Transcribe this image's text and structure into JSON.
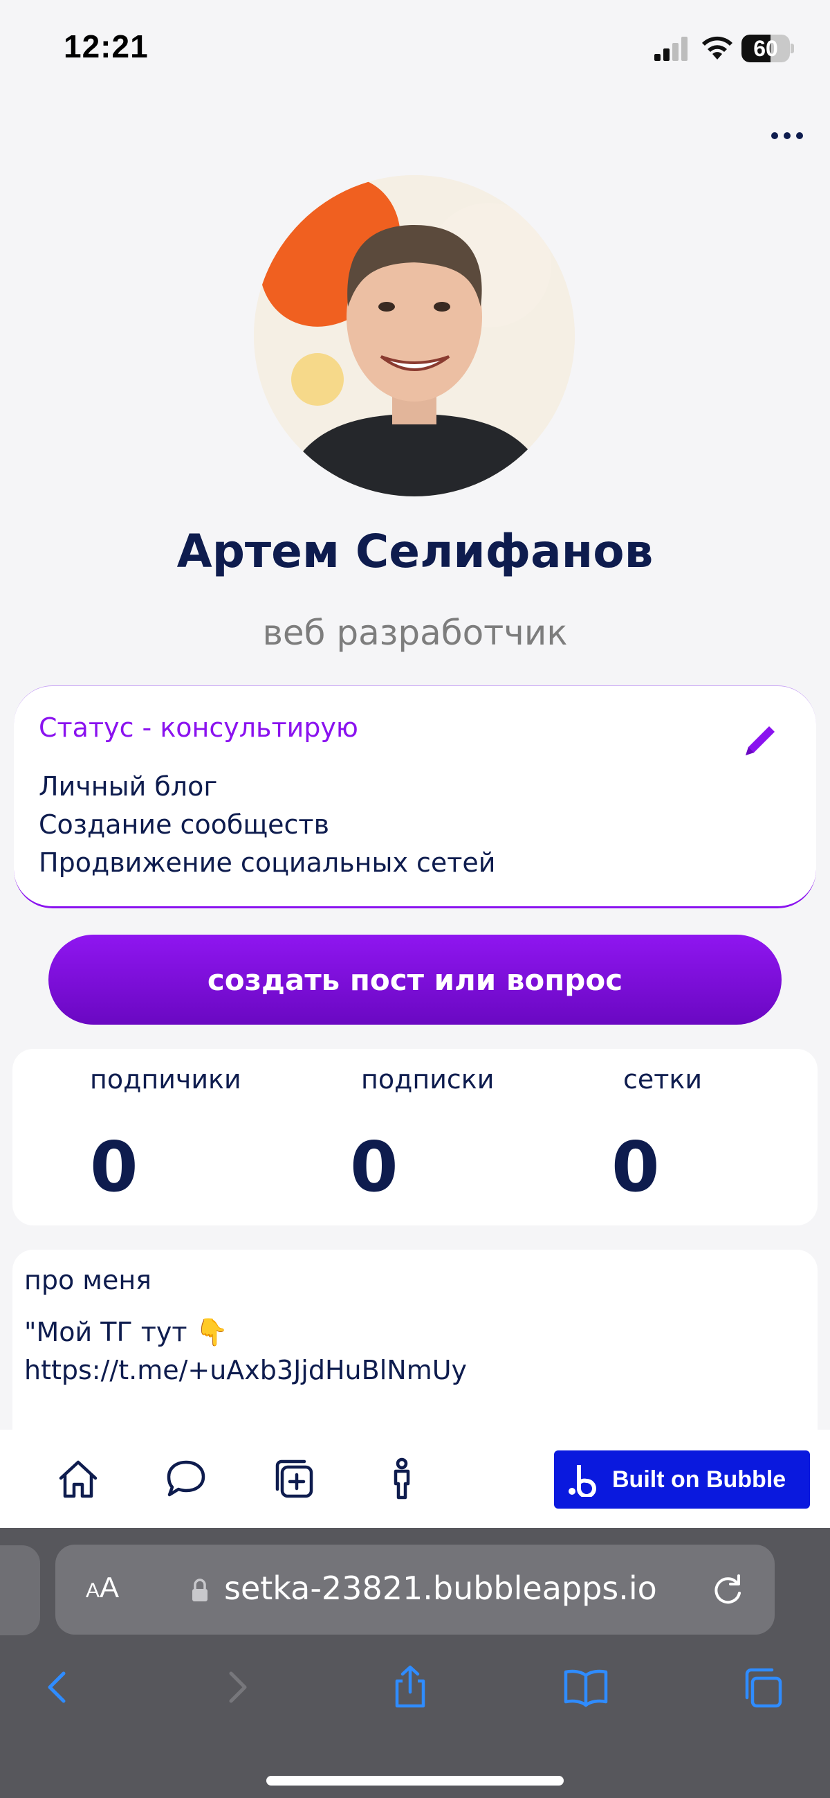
{
  "status_bar": {
    "time": "12:21",
    "battery": "60",
    "battery_level": 0.6
  },
  "profile": {
    "name": "Артем Селифанов",
    "profession": "веб разработчик"
  },
  "status_card": {
    "title": "Статус - консультирую",
    "lines": [
      "Личный блог",
      "Создание сообществ",
      "Продвижение социальных сетей"
    ]
  },
  "actions": {
    "create_label": "создать пост или вопрос"
  },
  "stats": {
    "items": [
      {
        "label": "подпичики",
        "value": "0"
      },
      {
        "label": "подписки",
        "value": "0"
      },
      {
        "label": "сетки",
        "value": "0"
      }
    ]
  },
  "about": {
    "title": "про меня",
    "line1": "\"Мой ТГ тут",
    "emoji": "👇",
    "line2": "https://t.me/+uAxb3JjdHuBlNmUy"
  },
  "bottom_nav": {
    "icons": [
      "home-icon",
      "chat-icon",
      "add-post-icon",
      "person-icon"
    ],
    "badge_label": "Built on Bubble"
  },
  "browser": {
    "aa_small": "A",
    "aa_big": "A",
    "url": "setka-23821.bubbleapps.io",
    "colors": {
      "accent": "#8a12ef",
      "navy": "#0e1c4e",
      "bubble": "#0a19de",
      "safari_blue": "#2f8cff"
    }
  }
}
